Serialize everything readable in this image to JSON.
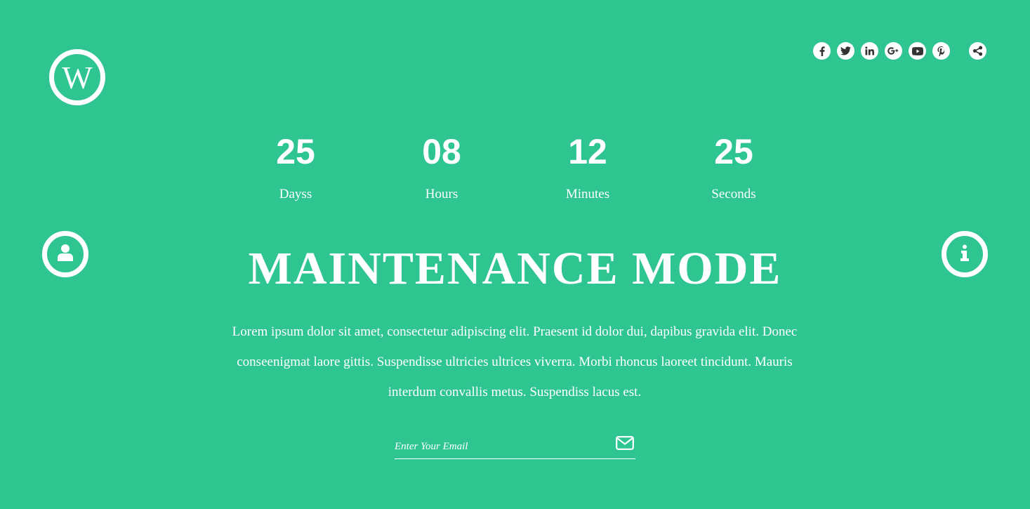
{
  "colors": {
    "background": "#2ec591",
    "foreground": "#ffffff",
    "icon_glyph": "#333333"
  },
  "logo": {
    "letter": "W",
    "icon": "wordpress-logo-icon"
  },
  "social": {
    "icons": [
      "facebook-icon",
      "twitter-icon",
      "linkedin-icon",
      "google-plus-icon",
      "youtube-icon",
      "pinterest-icon"
    ],
    "share_icon": "share-icon"
  },
  "side": {
    "left_icon": "user-icon",
    "right_icon": "info-icon"
  },
  "countdown": [
    {
      "value": "25",
      "label": "Dayss"
    },
    {
      "value": "08",
      "label": "Hours"
    },
    {
      "value": "12",
      "label": "Minutes"
    },
    {
      "value": "25",
      "label": "Seconds"
    }
  ],
  "title": "MAINTENANCE MODE",
  "description": "Lorem ipsum dolor sit amet, consectetur adipiscing elit. Praesent id dolor dui, dapibus gravida elit. Donec conseenigmat laore gittis. Suspendisse ultricies ultrices viverra. Morbi rhoncus laoreet tincidunt. Mauris interdum convallis metus. Suspendiss lacus est.",
  "email": {
    "placeholder": "Enter Your Email",
    "value": "",
    "submit_icon": "envelope-icon"
  }
}
